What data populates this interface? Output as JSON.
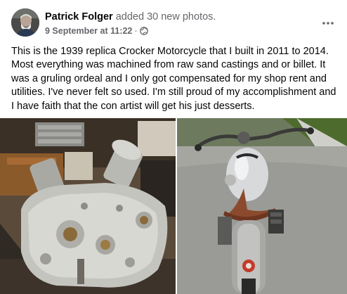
{
  "post": {
    "author": "Patrick Folger",
    "action": "added 30 new photos.",
    "timestamp": "9 September at 11:22",
    "separator": "·",
    "privacy_icon": "globe-icon",
    "menu_icon": "more-options-icon",
    "body": "This is the 1939 replica Crocker Motorcycle that I built in 2011 to 2014. Most everything was machined from raw sand castings and or billet. It was a gruling ordeal and I only got compensated for my shop rent and utilities. I've never felt so used. I'm still proud of my accomplishment and I have faith that the con artist will get his just desserts."
  },
  "colors": {
    "text_primary": "#050505",
    "text_secondary": "#65676b",
    "background": "#ffffff"
  }
}
